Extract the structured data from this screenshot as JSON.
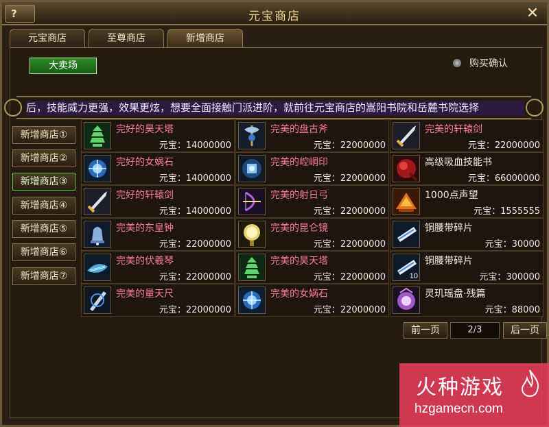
{
  "window": {
    "title": "元宝商店",
    "help_label": "?",
    "close_label": "✕"
  },
  "tabs": [
    {
      "label": "元宝商店",
      "active": false
    },
    {
      "label": "至尊商店",
      "active": false
    },
    {
      "label": "新增商店",
      "active": true
    }
  ],
  "auction_button": "大卖场",
  "purchase_confirm": {
    "label": "购买确认",
    "checked": false
  },
  "marquee": "后，技能威力更强，效果更炫，想要全面接触门派进阶，就前往元宝商店的嵩阳书院和岳麓书院选择",
  "side_tabs": [
    {
      "label": "新增商店①",
      "active": false
    },
    {
      "label": "新增商店②",
      "active": false
    },
    {
      "label": "新增商店③",
      "active": true
    },
    {
      "label": "新增商店④",
      "active": false
    },
    {
      "label": "新增商店⑤",
      "active": false
    },
    {
      "label": "新增商店⑥",
      "active": false
    },
    {
      "label": "新增商店⑦",
      "active": false
    }
  ],
  "items": [
    {
      "name": "完好的昊天塔",
      "price": "元宝：14000000",
      "color": "#ff7a9a",
      "icon": "pagoda-icon",
      "qty": ""
    },
    {
      "name": "完美的盘古斧",
      "price": "元宝：22000000",
      "color": "#ff7a9a",
      "icon": "axe-icon",
      "qty": ""
    },
    {
      "name": "完美的轩辕剑",
      "price": "元宝：22000000",
      "color": "#ff7a9a",
      "icon": "sword-icon",
      "qty": ""
    },
    {
      "name": "完好的女娲石",
      "price": "元宝：14000000",
      "color": "#ff7a9a",
      "icon": "stone-icon",
      "qty": ""
    },
    {
      "name": "完美的崆峒印",
      "price": "元宝：22000000",
      "color": "#ff7a9a",
      "icon": "seal-icon",
      "qty": ""
    },
    {
      "name": "高级吸血技能书",
      "price": "元宝：66000000",
      "color": "#f0ece0",
      "icon": "skill-book-icon",
      "qty": ""
    },
    {
      "name": "完好的轩辕剑",
      "price": "元宝：14000000",
      "color": "#ff7a9a",
      "icon": "sword-icon",
      "qty": ""
    },
    {
      "name": "完美的射日弓",
      "price": "元宝：22000000",
      "color": "#ff7a9a",
      "icon": "bow-icon",
      "qty": ""
    },
    {
      "name": "1000点声望",
      "price": "元宝：1555555",
      "color": "#f0ece0",
      "icon": "prestige-icon",
      "qty": ""
    },
    {
      "name": "完美的东皇钟",
      "price": "元宝：22000000",
      "color": "#ff7a9a",
      "icon": "bell-icon",
      "qty": ""
    },
    {
      "name": "完美的昆仑镜",
      "price": "元宝：22000000",
      "color": "#ff7a9a",
      "icon": "mirror-icon",
      "qty": ""
    },
    {
      "name": "铜腰带碎片",
      "price": "元宝：30000",
      "color": "#f0ece0",
      "icon": "belt-fragment-icon",
      "qty": ""
    },
    {
      "name": "完美的伏羲琴",
      "price": "元宝：22000000",
      "color": "#ff7a9a",
      "icon": "zither-icon",
      "qty": ""
    },
    {
      "name": "完美的昊天塔",
      "price": "元宝：22000000",
      "color": "#ff7a9a",
      "icon": "pagoda-icon",
      "qty": ""
    },
    {
      "name": "铜腰带碎片",
      "price": "元宝：300000",
      "color": "#f0ece0",
      "icon": "belt-fragment-icon",
      "qty": "10"
    },
    {
      "name": "完美的量天尺",
      "price": "元宝：22000000",
      "color": "#ff7a9a",
      "icon": "ruler-icon",
      "qty": ""
    },
    {
      "name": "完美的女娲石",
      "price": "元宝：22000000",
      "color": "#ff7a9a",
      "icon": "stone-icon",
      "qty": ""
    },
    {
      "name": "灵玑瑶盘·残篇",
      "price": "元宝：88000",
      "color": "#f0ece0",
      "icon": "jade-plate-icon",
      "qty": ""
    }
  ],
  "pager": {
    "prev_label": "前一页",
    "page_info": "2/3",
    "next_label": "后一页"
  },
  "watermark": {
    "title": "火种游戏",
    "url": "hzgamecn.com"
  },
  "colors": {
    "frame": "#6b5a3a",
    "background": "#2a1f14",
    "legendary_name": "#ff7a9a",
    "normal_name": "#f0ece0",
    "active_side_tab": "#60d040",
    "watermark_bg": "#e63c5a"
  }
}
